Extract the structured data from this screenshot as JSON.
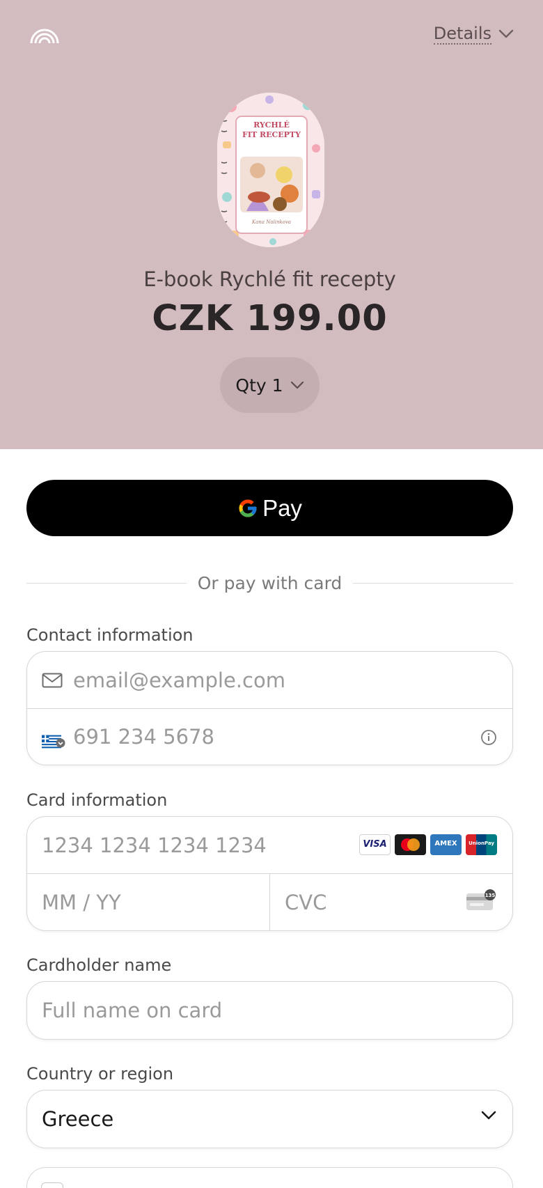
{
  "header": {
    "details_label": "Details",
    "product_name": "E-book Rychlé fit recepty",
    "price": "CZK 199.00",
    "qty_label": "Qty 1",
    "book_cover": {
      "title_line1": "RYCHLÉ",
      "title_line2": "FIT RECEPTY",
      "author": "Kana Nalinkova"
    }
  },
  "payment": {
    "gpay_label": "Pay",
    "divider_text": "Or pay with card"
  },
  "contact": {
    "label": "Contact information",
    "email_placeholder": "email@example.com",
    "phone_placeholder": "691 234 5678"
  },
  "card": {
    "label": "Card information",
    "number_placeholder": "1234 1234 1234 1234",
    "expiry_placeholder": "MM / YY",
    "cvc_placeholder": "CVC",
    "cvc_hint": "135",
    "brands": [
      "VISA",
      "Mastercard",
      "AMEX",
      "UnionPay"
    ]
  },
  "cardholder": {
    "label": "Cardholder name",
    "placeholder": "Full name on card"
  },
  "country": {
    "label": "Country or region",
    "value": "Greece"
  },
  "colors": {
    "header_bg": "#d3bcbf",
    "qty_bg": "#c4aeb1",
    "gpay_bg": "#000000",
    "border": "#d6d6d6"
  }
}
